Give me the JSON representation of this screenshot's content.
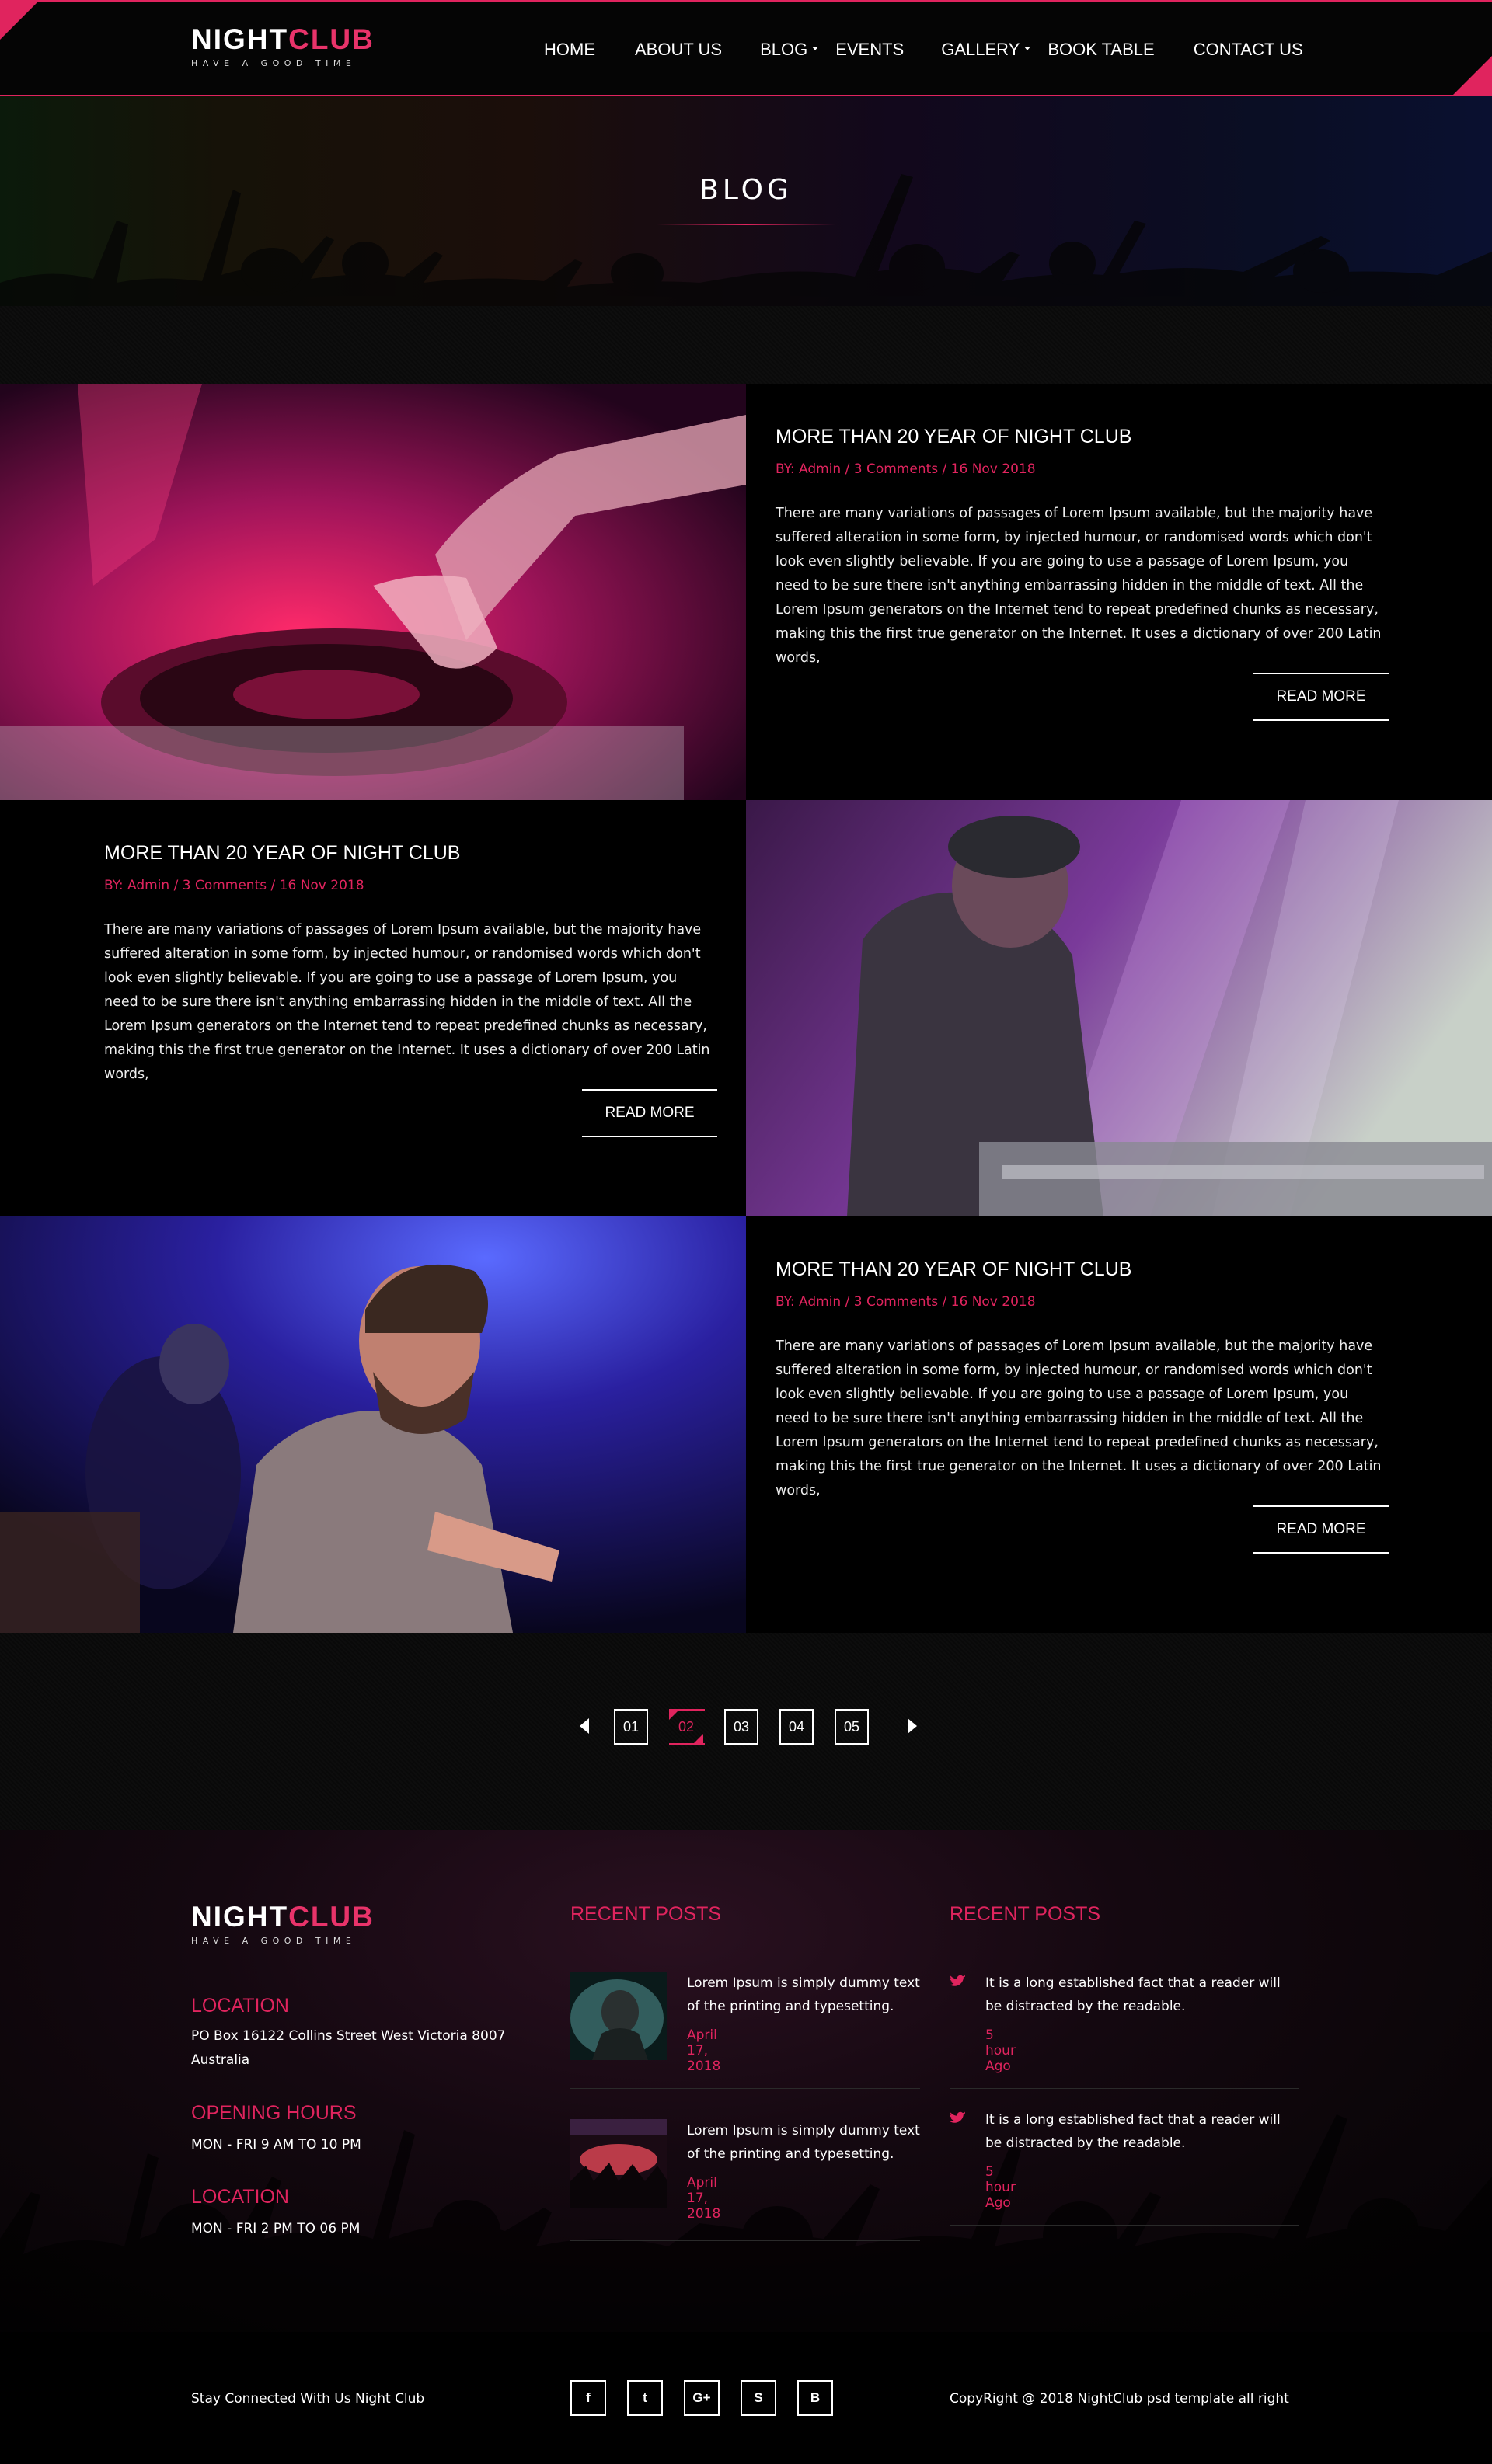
{
  "brand": {
    "name_white": "NIGHT",
    "name_pink": "CLUB",
    "tagline": "HAVE A GOOD TIME"
  },
  "nav": {
    "items": [
      {
        "label": "HOME",
        "dropdown": false
      },
      {
        "label": "ABOUT US",
        "dropdown": false
      },
      {
        "label": "BLOG",
        "dropdown": true
      },
      {
        "label": "EVENTS",
        "dropdown": false
      },
      {
        "label": "GALLERY",
        "dropdown": true
      },
      {
        "label": "BOOK TABLE",
        "dropdown": false
      },
      {
        "label": "CONTACT US",
        "dropdown": false
      }
    ]
  },
  "hero": {
    "title": "BLOG"
  },
  "posts": [
    {
      "title": "MORE THAN 20 YEAR OF NIGHT CLUB",
      "by": "BY:",
      "author": "Admin",
      "sep1": " / ",
      "comments": "3 Comments",
      "sep2": " / ",
      "date": "16 Nov 2018",
      "text": "There are many variations of passages of Lorem Ipsum available, but the majority have suffered alteration in some form, by injected humour, or randomised words which don't look even slightly believable. If you are going to use a passage of Lorem Ipsum, you need to be sure there isn't anything embarrassing hidden in the middle of text. All the Lorem Ipsum generators on the Internet tend to repeat predefined chunks as necessary, making this the first true generator on the Internet. It uses a dictionary of over 200 Latin words,",
      "read_more": "READ MORE",
      "image": "dj-turntable-photo"
    },
    {
      "title": "MORE THAN 20 YEAR OF NIGHT CLUB",
      "by": "BY:",
      "author": "Admin",
      "sep1": " / ",
      "comments": "3 Comments",
      "sep2": " / ",
      "date": "16 Nov 2018",
      "text": "There are many variations of passages of Lorem Ipsum available, but the majority have suffered alteration in some form, by injected humour, or randomised words which don't look even slightly believable. If you are going to use a passage of Lorem Ipsum, you need to be sure there isn't anything embarrassing hidden in the middle of text. All the Lorem Ipsum generators on the Internet tend to repeat predefined chunks as necessary, making this the first true generator on the Internet. It uses a dictionary of over 200 Latin words,",
      "read_more": "READ MORE",
      "image": "dj-mixing-photo"
    },
    {
      "title": "MORE THAN 20 YEAR OF NIGHT CLUB",
      "by": "BY:",
      "author": "Admin",
      "sep1": " / ",
      "comments": "3 Comments",
      "sep2": " / ",
      "date": "16 Nov 2018",
      "text": "There are many variations of passages of Lorem Ipsum available, but the majority have suffered alteration in some form, by injected humour, or randomised words which don't look even slightly believable. If you are going to use a passage of Lorem Ipsum, you need to be sure there isn't anything embarrassing hidden in the middle of text. All the Lorem Ipsum generators on the Internet tend to repeat predefined chunks as necessary, making this the first true generator on the Internet. It uses a dictionary of over 200 Latin words,",
      "read_more": "READ MORE",
      "image": "band-performer-photo"
    }
  ],
  "pagination": {
    "pages": [
      "01",
      "02",
      "03",
      "04",
      "05"
    ],
    "current": "02",
    "prev_icon": "arrow-left-icon",
    "next_icon": "arrow-right-icon"
  },
  "footer": {
    "location_heading": "LOCATION",
    "address_line1": "PO Box 16122 Collins Street West Victoria 8007",
    "address_line2": "Australia",
    "hours_heading": "OPENING HOURS",
    "hours": "MON - FRI 9 AM TO 10 PM",
    "location2_heading": "LOCATION",
    "hours2": "MON - FRI 2 PM TO 06 PM",
    "recent_posts_heading": "RECENT POSTS",
    "recent_posts": [
      {
        "text": "Lorem Ipsum is simply dummy text of the printing and typesetting.",
        "date": "April 17, 2018"
      },
      {
        "text": "Lorem Ipsum is simply dummy text of the printing and typesetting.",
        "date": "April 17, 2018"
      }
    ],
    "tweets_heading": "RECENT POSTS",
    "tweets": [
      {
        "text": "It is a long established fact that a reader will be distracted by the readable.",
        "time": "5 hour Ago"
      },
      {
        "text": "It is a long established fact that a reader will be distracted by the readable.",
        "time": "5 hour Ago"
      }
    ]
  },
  "bottom": {
    "stay_connected": "Stay Connected With Us Night Club",
    "copyright": "CopyRight @ 2018 NightClub psd template all right",
    "social": [
      {
        "icon": "facebook-icon",
        "glyph": "f"
      },
      {
        "icon": "twitter-icon",
        "glyph": "t"
      },
      {
        "icon": "google-plus-icon",
        "glyph": "G+"
      },
      {
        "icon": "skype-icon",
        "glyph": "S"
      },
      {
        "icon": "blogger-icon",
        "glyph": "B"
      }
    ]
  },
  "colors": {
    "accent": "#e0245e",
    "background": "#000000"
  }
}
